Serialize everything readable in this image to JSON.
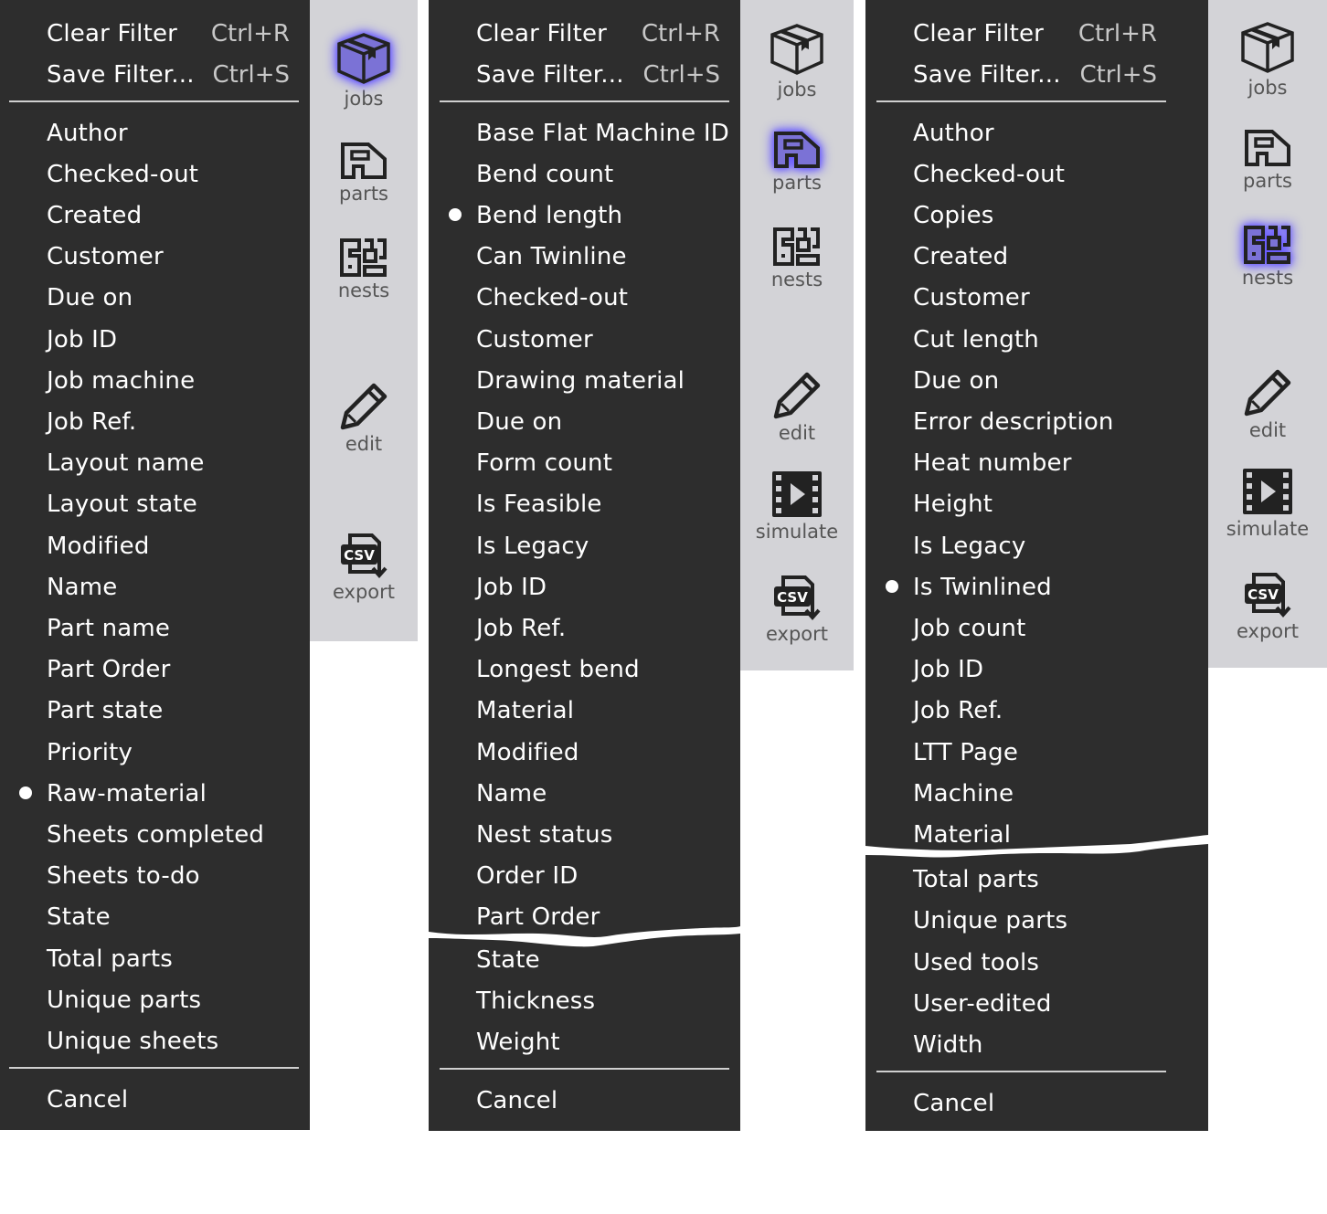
{
  "filter_actions": {
    "clear_label": "Clear Filter",
    "clear_shortcut": "Ctrl+R",
    "save_label": "Save Filter...",
    "save_shortcut": "Ctrl+S"
  },
  "cancel_label": "Cancel",
  "toolbar": {
    "jobs": "jobs",
    "parts": "parts",
    "nests": "nests",
    "edit": "edit",
    "simulate": "simulate",
    "export": "export"
  },
  "icons": {
    "jobs": "box-icon",
    "parts": "part-icon",
    "nests": "nest-icon",
    "edit": "pencil-icon",
    "simulate": "film-play-icon",
    "export": "csv-export-icon"
  },
  "colors": {
    "menu_bg": "#2d2d2d",
    "toolbar_bg": "#d3d3d7",
    "active_glow": "#6a5cff"
  },
  "panels": [
    {
      "context": "jobs",
      "selected": "Raw-material",
      "items": [
        "Author",
        "Checked-out",
        "Created",
        "Customer",
        "Due on",
        "Job ID",
        "Job machine",
        "Job Ref.",
        "Layout name",
        "Layout state",
        "Modified",
        "Name",
        "Part name",
        "Part Order",
        "Part state",
        "Priority",
        "Raw-material",
        "Sheets completed",
        "Sheets to-do",
        "State",
        "Total parts",
        "Unique parts",
        "Unique sheets"
      ]
    },
    {
      "context": "parts",
      "selected": "Bend length",
      "items": [
        "Base Flat Machine ID",
        "Bend count",
        "Bend length",
        "Can Twinline",
        "Checked-out",
        "Customer",
        "Drawing material",
        "Due on",
        "Form count",
        "Is Feasible",
        "Is Legacy",
        "Job ID",
        "Job Ref.",
        "Longest bend",
        "Material",
        "Modified",
        "Name",
        "Nest status",
        "Order ID",
        "Part Order",
        "State",
        "Thickness",
        "Weight"
      ]
    },
    {
      "context": "nests",
      "selected": "Is Twinlined",
      "items": [
        "Author",
        "Checked-out",
        "Copies",
        "Created",
        "Customer",
        "Cut length",
        "Due on",
        "Error description",
        "Heat number",
        "Height",
        "Is Legacy",
        "Is Twinlined",
        "Job count",
        "Job ID",
        "Job Ref.",
        "LTT Page",
        "Machine",
        "Material",
        "Total parts",
        "Unique parts",
        "Used tools",
        "User-edited",
        "Width"
      ]
    }
  ]
}
